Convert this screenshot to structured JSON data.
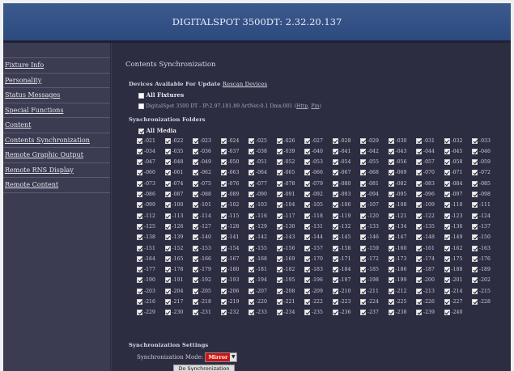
{
  "header": {
    "title": "DIGITALSPOT 3500DT: 2.32.20.137"
  },
  "sidebar": {
    "items": [
      {
        "label": "Fixture Info"
      },
      {
        "label": "Personality"
      },
      {
        "label": "Status Messages"
      },
      {
        "label": "Special Functions"
      },
      {
        "label": "Content"
      },
      {
        "label": "Contents Synchronization"
      },
      {
        "label": "Remote Graphic Output"
      },
      {
        "label": "Remote RNS Display"
      },
      {
        "label": "Remote Content"
      }
    ]
  },
  "main": {
    "title": "Contents Synchronization",
    "devices": {
      "heading": "Devices Available For Update",
      "rescan_label": "Rescan Devices",
      "all_fixtures_label": "All Fixtures",
      "fixture_text": "DigitalSpot 3500 DT - IP:2.97.181.89 ArtNet:0.1 Dmx:001",
      "http_label": "Http",
      "pin_label": "Pin"
    },
    "folders": {
      "heading": "Synchronization Folders",
      "all_media_label": "All Media",
      "start": 21,
      "end": 240,
      "per_row": 13,
      "checked": true
    },
    "settings": {
      "heading": "Synchronization Settings",
      "mode_label": "Synchronization Mode:",
      "mode_value": "Mirror",
      "button_label": "Do Synchronization"
    }
  },
  "colors": {
    "header": "#2c4a7e",
    "sidebar": "#3b3b52",
    "main": "#2d2d42",
    "mode_accent": "#cc1414"
  }
}
